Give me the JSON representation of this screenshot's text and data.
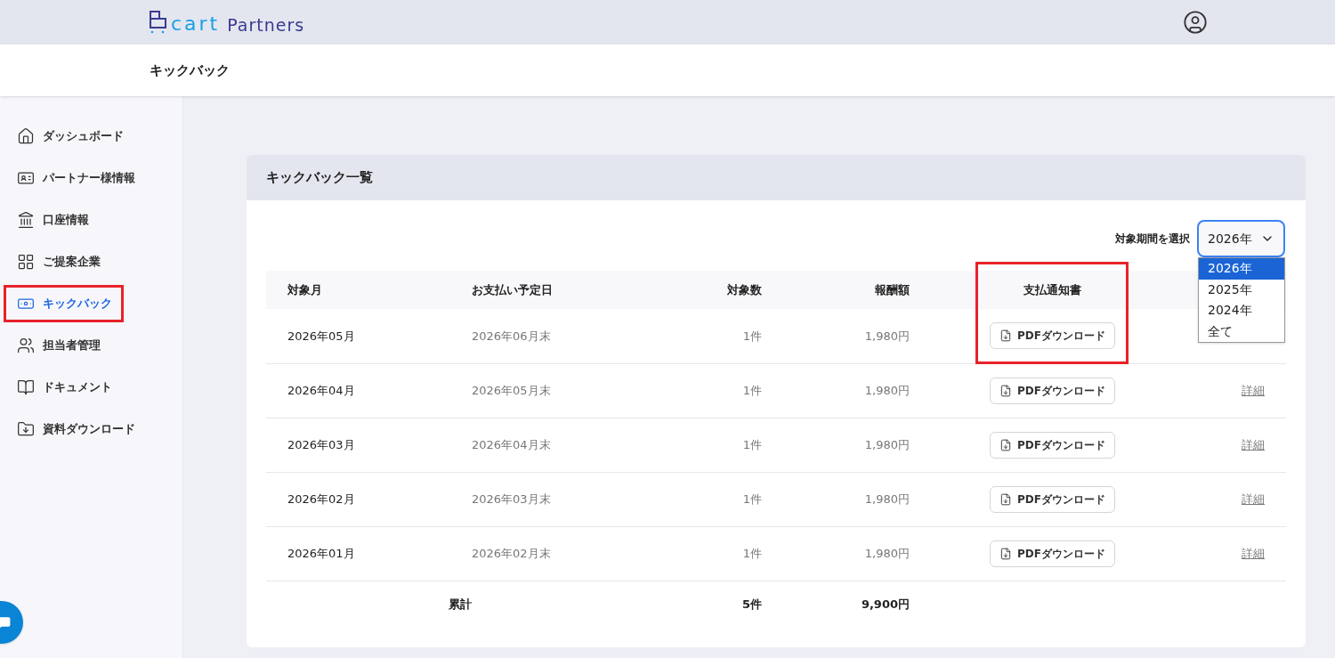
{
  "header": {
    "logo": {
      "mark": "cart",
      "name": "Partners"
    }
  },
  "page_title": "キックバック",
  "sidebar": {
    "items": [
      {
        "label": "ダッシュボード",
        "selected": false,
        "highlighted": false
      },
      {
        "label": "パートナー様情報",
        "selected": false,
        "highlighted": false
      },
      {
        "label": "口座情報",
        "selected": false,
        "highlighted": false
      },
      {
        "label": "ご提案企業",
        "selected": false,
        "highlighted": false
      },
      {
        "label": "キックバック",
        "selected": true,
        "highlighted": true
      },
      {
        "label": "担当者管理",
        "selected": false,
        "highlighted": false
      },
      {
        "label": "ドキュメント",
        "selected": false,
        "highlighted": false
      },
      {
        "label": "資料ダウンロード",
        "selected": false,
        "highlighted": false
      }
    ]
  },
  "card": {
    "title": "キックバック一覧",
    "period_filter": {
      "label": "対象期間を選択",
      "value": "2026年",
      "expanded": true,
      "options": [
        {
          "label": "2026年",
          "selected": true
        },
        {
          "label": "2025年",
          "selected": false
        },
        {
          "label": "2024年",
          "selected": false
        },
        {
          "label": "全て",
          "selected": false
        }
      ]
    },
    "table": {
      "columns": [
        {
          "label": "対象月",
          "highlighted": false
        },
        {
          "label": "お支払い予定日",
          "highlighted": false
        },
        {
          "label": "対象数",
          "highlighted": false
        },
        {
          "label": "報酬額",
          "highlighted": false
        },
        {
          "label": "支払通知書",
          "highlighted": true
        }
      ],
      "rows": [
        {
          "month": "2026年05月",
          "payment_date": "2026年06月末",
          "count": "1件",
          "amount": "1,980円",
          "download": "PDFダウンロード"
        },
        {
          "month": "2026年04月",
          "payment_date": "2026年05月末",
          "count": "1件",
          "amount": "1,980円",
          "download": "PDFダウンロード",
          "detail": "詳細"
        },
        {
          "month": "2026年03月",
          "payment_date": "2026年04月末",
          "count": "1件",
          "amount": "1,980円",
          "download": "PDFダウンロード",
          "detail": "詳細"
        },
        {
          "month": "2026年02月",
          "payment_date": "2026年03月末",
          "count": "1件",
          "amount": "1,980円",
          "download": "PDFダウンロード",
          "detail": "詳細"
        },
        {
          "month": "2026年01月",
          "payment_date": "2026年02月末",
          "count": "1件",
          "amount": "1,980円",
          "download": "PDFダウンロード",
          "detail": "詳細"
        }
      ],
      "total": {
        "label": "累計",
        "count": "5件",
        "amount": "9,900円"
      }
    }
  }
}
